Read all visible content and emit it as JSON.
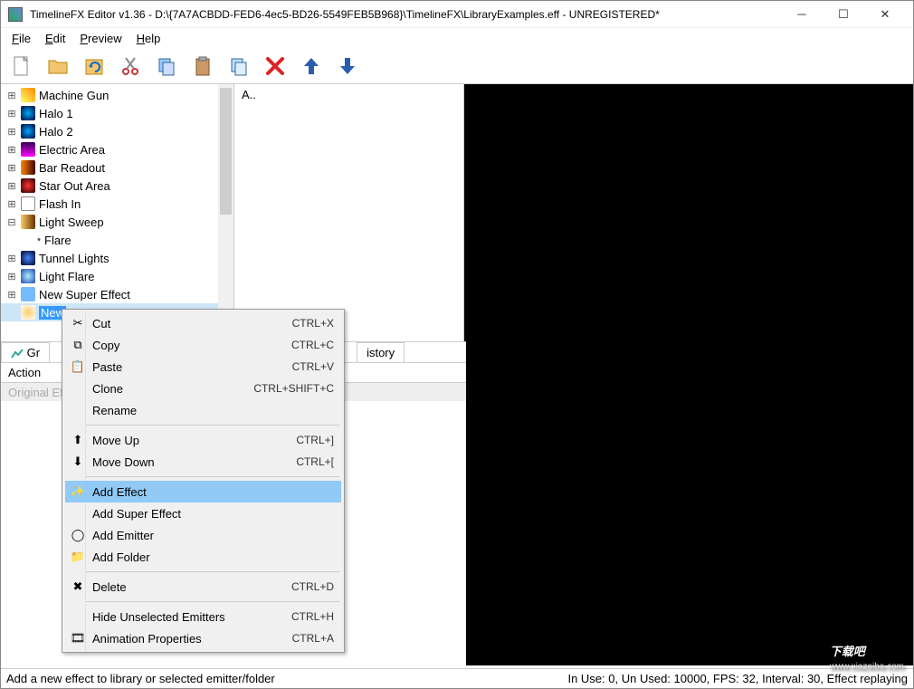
{
  "titlebar": {
    "title": "TimelineFX Editor v1.36 - D:\\{7A7ACBDD-FED6-4ec5-BD26-5549FEB5B968}\\TimelineFX\\LibraryExamples.eff - UNREGISTERED*"
  },
  "menubar": {
    "file": "File",
    "edit": "Edit",
    "preview": "Preview",
    "help": "Help"
  },
  "tree": {
    "items": [
      {
        "label": "Machine Gun",
        "icon": "ic-machine",
        "exp": "⊞"
      },
      {
        "label": "Halo 1",
        "icon": "ic-halo",
        "exp": "⊞"
      },
      {
        "label": "Halo 2",
        "icon": "ic-halo",
        "exp": "⊞"
      },
      {
        "label": "Electric Area",
        "icon": "ic-elec",
        "exp": "⊞"
      },
      {
        "label": "Bar Readout",
        "icon": "ic-bar",
        "exp": "⊞"
      },
      {
        "label": "Star Out Area",
        "icon": "ic-star",
        "exp": "⊞"
      },
      {
        "label": "Flash In",
        "icon": "ic-flash",
        "exp": "⊞"
      },
      {
        "label": "Light Sweep",
        "icon": "ic-sweep",
        "exp": "⊟"
      },
      {
        "label": "Flare",
        "icon": "",
        "exp": "•",
        "child": true
      },
      {
        "label": "Tunnel Lights",
        "icon": "ic-tunnel",
        "exp": "⊞"
      },
      {
        "label": "Light Flare",
        "icon": "ic-flare",
        "exp": "⊞"
      },
      {
        "label": "New Super Effect",
        "icon": "ic-super",
        "exp": "⊞"
      },
      {
        "label": "New",
        "icon": "ic-new",
        "exp": "",
        "selected": true
      }
    ]
  },
  "mid": {
    "header": "A.."
  },
  "lower": {
    "tabs": [
      "Gr",
      "istory"
    ],
    "col_action": "Action",
    "row_original": "Original Ef"
  },
  "context_menu": {
    "items": [
      {
        "label": "Cut",
        "shortcut": "CTRL+X",
        "icon": "✂"
      },
      {
        "label": "Copy",
        "shortcut": "CTRL+C",
        "icon": "⧉"
      },
      {
        "label": "Paste",
        "shortcut": "CTRL+V",
        "icon": "📋"
      },
      {
        "label": "Clone",
        "shortcut": "CTRL+SHIFT+C",
        "icon": ""
      },
      {
        "label": "Rename",
        "shortcut": "",
        "icon": ""
      },
      {
        "sep": true
      },
      {
        "label": "Move Up",
        "shortcut": "CTRL+]",
        "icon": "⬆"
      },
      {
        "label": "Move Down",
        "shortcut": "CTRL+[",
        "icon": "⬇"
      },
      {
        "sep": true
      },
      {
        "label": "Add Effect",
        "shortcut": "",
        "icon": "✨",
        "highlight": true
      },
      {
        "label": "Add Super Effect",
        "shortcut": "",
        "icon": ""
      },
      {
        "label": "Add Emitter",
        "shortcut": "",
        "icon": "◯"
      },
      {
        "label": "Add Folder",
        "shortcut": "",
        "icon": "📁"
      },
      {
        "sep": true
      },
      {
        "label": "Delete",
        "shortcut": "CTRL+D",
        "icon": "✖"
      },
      {
        "sep": true
      },
      {
        "label": "Hide Unselected Emitters",
        "shortcut": "CTRL+H",
        "icon": ""
      },
      {
        "label": "Animation Properties",
        "shortcut": "CTRL+A",
        "icon": "🎞"
      }
    ]
  },
  "statusbar": {
    "left": "Add a new effect to library or selected emitter/folder",
    "right": "In Use: 0, Un Used: 10000, FPS: 32, Interval: 30, Effect replaying"
  },
  "watermark": {
    "main": "下载吧",
    "sub": "www.xiazaiba.com"
  }
}
